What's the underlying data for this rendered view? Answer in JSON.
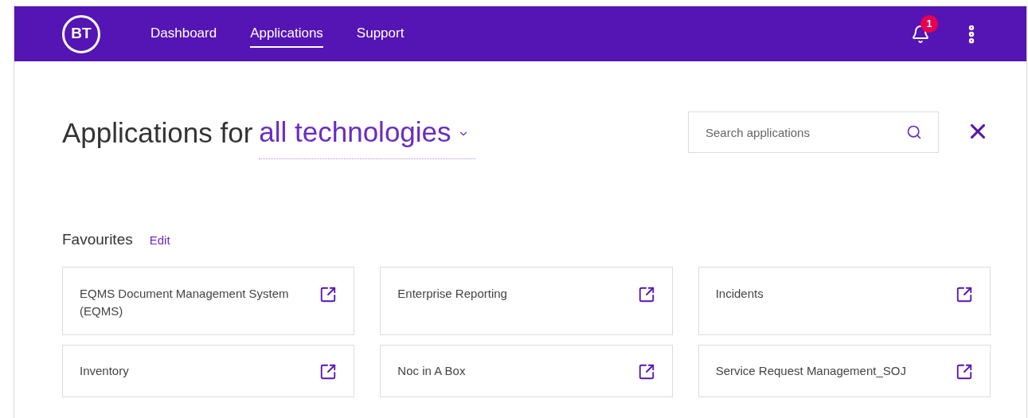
{
  "header": {
    "logo": "BT",
    "nav": [
      {
        "label": "Dashboard",
        "selected": false
      },
      {
        "label": "Applications",
        "selected": true
      },
      {
        "label": "Support",
        "selected": false
      }
    ],
    "notification_count": "1"
  },
  "title": {
    "prefix": "Applications for",
    "filter": "all technologies"
  },
  "search": {
    "placeholder": "Search applications"
  },
  "favourites": {
    "heading": "Favourites",
    "edit": "Edit",
    "apps": [
      {
        "name": "EQMS Document Management System (EQMS)"
      },
      {
        "name": "Enterprise Reporting"
      },
      {
        "name": "Incidents"
      },
      {
        "name": "Inventory"
      },
      {
        "name": "Noc in A Box"
      },
      {
        "name": "Service Request Management_SOJ"
      }
    ]
  }
}
